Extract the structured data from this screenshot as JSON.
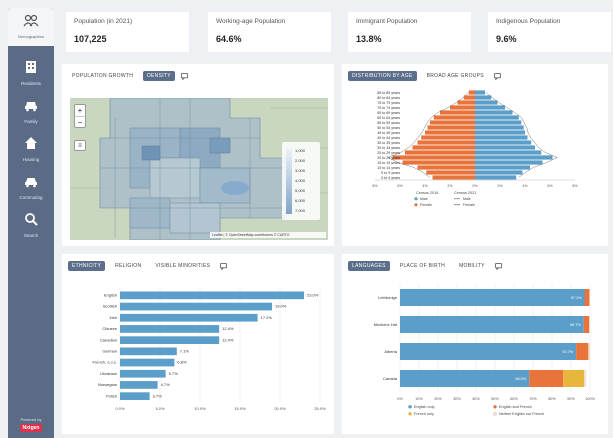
{
  "sidebar": {
    "brand_label": "Demographics",
    "items": [
      {
        "label": "Residents",
        "icon": "building-icon"
      },
      {
        "label": "Family",
        "icon": "family-icon"
      },
      {
        "label": "Housing",
        "icon": "house-icon"
      },
      {
        "label": "Commuting",
        "icon": "car-icon"
      },
      {
        "label": "Search",
        "icon": "search-icon"
      }
    ],
    "powered_by": "Powered by",
    "badge": "Nxtgen"
  },
  "kpis": [
    {
      "title": "Population (in 2021)",
      "value": "107,225"
    },
    {
      "title": "Working-age Population",
      "value": "64.6%"
    },
    {
      "title": "Immigrant Population",
      "value": "13.8%"
    },
    {
      "title": "Indigenous Population",
      "value": "9.6%"
    }
  ],
  "map_panel": {
    "tabs": [
      "Population Growth",
      "Density"
    ],
    "active_tab": 1,
    "legend": [
      "1,000",
      "2,000",
      "3,000",
      "4,000",
      "5,000",
      "6,000",
      "7,000"
    ],
    "attribution": "Leaflet | © OpenStreetMap contributors © CARTO"
  },
  "pyramid_panel": {
    "tabs": [
      "Distribution by Age",
      "Broad Age Groups"
    ],
    "active_tab": 0,
    "legend": {
      "header_left": "Census 2016",
      "header_right": "Census 2021",
      "items": [
        "Male",
        "Female",
        "Male",
        "Female"
      ]
    },
    "colors": {
      "male": "#e8743b",
      "female": "#5b9ec9"
    }
  },
  "bar_panel": {
    "tabs": [
      "Ethnicity",
      "Religion",
      "Visible Minorities"
    ],
    "active_tab": 0
  },
  "lang_panel": {
    "tabs": [
      "Languages",
      "Place of Birth",
      "Mobility"
    ],
    "active_tab": 0,
    "legend": [
      "English only",
      "English and French",
      "French only",
      "Neither English nor French"
    ],
    "colors": [
      "#5b9ec9",
      "#e8743b",
      "#e8b63b",
      "#e8e2cf"
    ]
  },
  "chart_data": [
    {
      "type": "bar",
      "title": "Population pyramid",
      "categories": [
        "85 to 89 years",
        "80 to 84 years",
        "75 to 79 years",
        "70 to 74 years",
        "65 to 69 years",
        "60 to 64 years",
        "55 to 59 years",
        "50 to 54 years",
        "45 to 49 years",
        "40 to 44 years",
        "35 to 39 years",
        "30 to 34 years",
        "25 to 29 years",
        "20 to 24 years",
        "15 to 19 years",
        "10 to 14 years",
        "5 to 9 years",
        "0 to 4 years"
      ],
      "series": [
        {
          "name": "Male",
          "values": [
            -0.5,
            -0.9,
            -1.4,
            -2.0,
            -2.8,
            -3.3,
            -3.6,
            -3.8,
            -4.0,
            -4.3,
            -4.6,
            -5.0,
            -5.6,
            -6.6,
            -5.8,
            -4.6,
            -3.9,
            -3.4
          ]
        },
        {
          "name": "Female",
          "values": [
            0.8,
            1.3,
            1.8,
            2.4,
            3.0,
            3.5,
            3.7,
            3.9,
            4.0,
            4.2,
            4.5,
            4.8,
            5.3,
            6.2,
            5.4,
            4.4,
            3.8,
            3.3
          ]
        }
      ],
      "xlim": [
        -8,
        8
      ],
      "xticks": [
        "8%",
        "6%",
        "4%",
        "2%",
        "0%",
        "2%",
        "4%",
        "6%",
        "8%"
      ]
    },
    {
      "type": "bar",
      "orientation": "horizontal",
      "categories": [
        "English",
        "Scottish",
        "Irish",
        "Chinese",
        "Canadian",
        "German",
        "French, n.o.s.",
        "Ukrainian",
        "Norwegian",
        "Polish"
      ],
      "values": [
        23.0,
        19.0,
        17.2,
        12.4,
        12.4,
        7.1,
        6.8,
        5.7,
        4.7,
        3.7
      ],
      "value_labels": [
        "23.0%",
        "19.0%",
        "17.2%",
        "12.4%",
        "12.4%",
        "7.1%",
        "6.8%",
        "5.7%",
        "4.7%",
        "3.7%"
      ],
      "xlim": [
        0,
        25
      ],
      "xticks": [
        "0.0%",
        "5.0%",
        "10.0%",
        "15.0%",
        "20.0%",
        "25.0%"
      ]
    },
    {
      "type": "bar",
      "orientation": "horizontal",
      "stacked": true,
      "categories": [
        "Lethbridge",
        "Medicine Hat",
        "Alberta",
        "Canada"
      ],
      "series": [
        {
          "name": "English only",
          "values": [
            97.1,
            96.7,
            92.7,
            68.0
          ]
        },
        {
          "name": "English and French",
          "values": [
            2.6,
            2.9,
            6.4,
            17.9
          ]
        },
        {
          "name": "French only",
          "values": [
            0.0,
            0.0,
            0.1,
            11.0
          ]
        },
        {
          "name": "Neither English nor French",
          "values": [
            0.3,
            0.4,
            0.8,
            1.1
          ]
        }
      ],
      "value_labels": [
        "97.1%",
        "96.7%",
        "92.7%",
        "68.0%"
      ],
      "xlim": [
        0,
        100
      ],
      "xticks": [
        "0%",
        "10%",
        "20%",
        "30%",
        "40%",
        "50%",
        "60%",
        "70%",
        "80%",
        "90%",
        "100%"
      ]
    }
  ]
}
